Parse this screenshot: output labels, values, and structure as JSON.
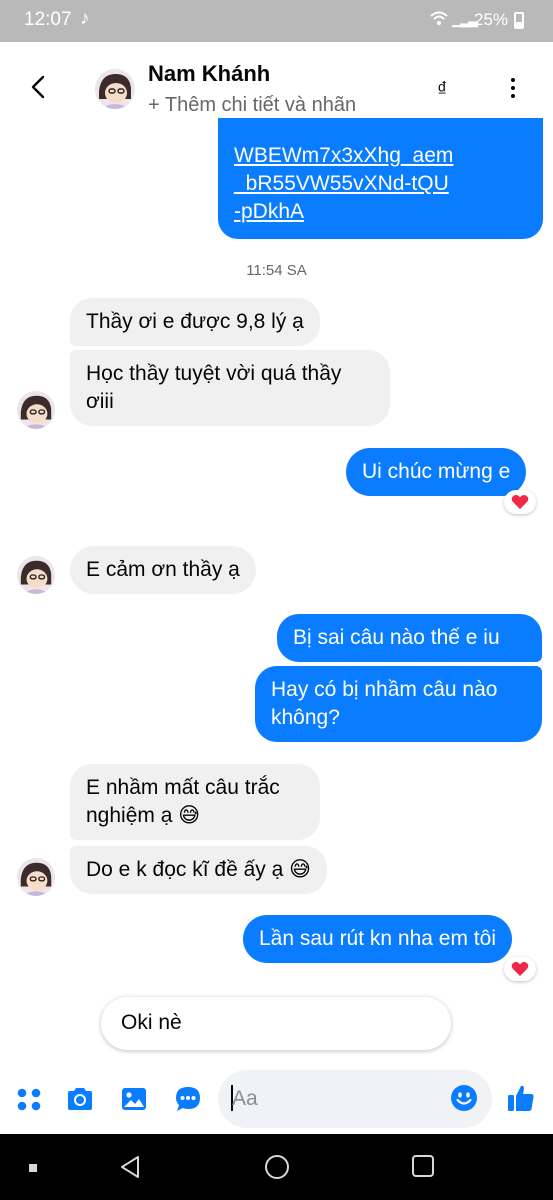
{
  "status_bar": {
    "time": "12:07",
    "battery": "25%",
    "tiktok_glyph": "♪"
  },
  "header": {
    "name": "Nam Khánh",
    "subtitle": "+ Thêm chi tiết và nhãn",
    "currency_icon_text": "₫",
    "icons": [
      "back-arrow-icon",
      "avatar",
      "currency-icon",
      "more-icon"
    ]
  },
  "messages": {
    "link": {
      "line1": "WBEWm7x3xXhg_aem",
      "line2": "_bR55VW55vXNd-tQU",
      "line3": "-pDkhA"
    },
    "timestamp": "11:54 SA",
    "m1": "Thầy ơi e được 9,8 lý ạ",
    "m2_line1": "Học thầy tuyệt vời quá thầy",
    "m2_line2": "ơiii",
    "m3": "Ui chúc mừng e",
    "m4": "E cảm ơn thầy ạ",
    "m5": "Bị sai câu nào thế e iu",
    "m6_line1": "Hay có bị nhầm câu nào",
    "m6_line2": "không?",
    "m7_line1": "E nhầm mất câu trắc",
    "m7_line2": "nghiệm ạ 😅",
    "m8": "Do e k đọc kĩ đề ấy ạ 😅",
    "m9": "Lần sau rút kn nha em tôi"
  },
  "quick_reply": "Oki nè",
  "composer": {
    "placeholder": "Aa",
    "icons": [
      "apps-icon",
      "camera-icon",
      "gallery-icon",
      "chat-bubble-icon",
      "emoji-icon",
      "thumbs-up-icon"
    ]
  },
  "colors": {
    "accent": "#0a7cff",
    "incoming": "#f0f0f0",
    "reaction_heart": "#f02849"
  }
}
